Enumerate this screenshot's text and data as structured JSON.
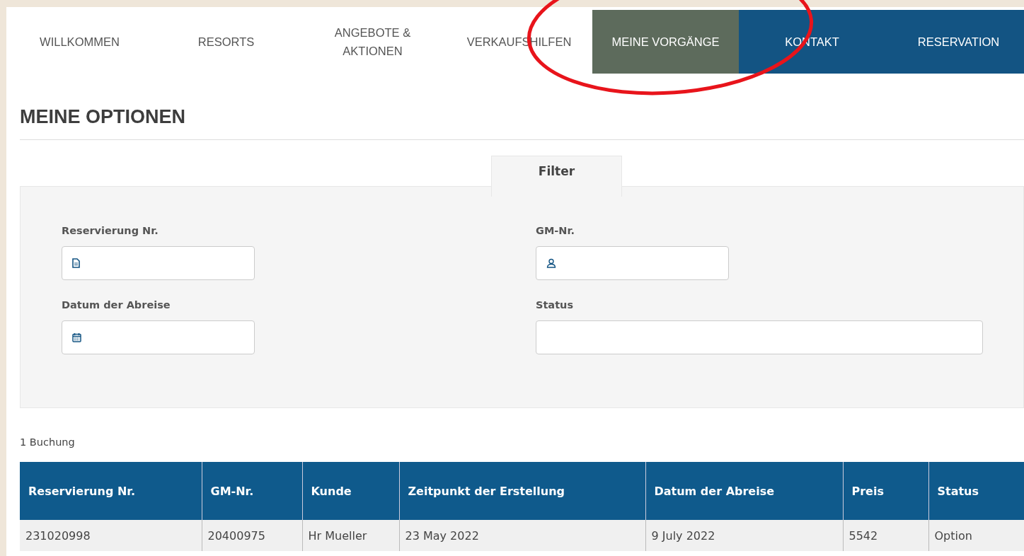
{
  "nav": [
    {
      "label": "WILLKOMMEN",
      "kind": "plain",
      "selected": false
    },
    {
      "label": "RESORTS",
      "kind": "plain",
      "selected": false
    },
    {
      "label": "ANGEBOTE & AKTIONEN",
      "kind": "plain",
      "selected": false
    },
    {
      "label": "VERKAUFSHILFEN",
      "kind": "plain",
      "selected": false
    },
    {
      "label": "MEINE VORGÄNGE",
      "kind": "plain",
      "selected": true
    },
    {
      "label": "KONTAKT",
      "kind": "cta",
      "selected": false
    },
    {
      "label": "RESERVATION",
      "kind": "cta",
      "selected": false
    }
  ],
  "page_title": "MEINE OPTIONEN",
  "filter": {
    "tab": "Filter",
    "fields": [
      {
        "label": "Reservierung Nr.",
        "kind": "document"
      },
      {
        "label": "GM-Nr.",
        "kind": "person"
      },
      {
        "label": "Datum der Abreise",
        "kind": "date"
      },
      {
        "label": "Status",
        "kind": "select"
      }
    ]
  },
  "result_count": "1 Buchung",
  "table": {
    "columns": [
      "Reservierung Nr.",
      "GM-Nr.",
      "Kunde",
      "Zeitpunkt der Erstellung",
      "Datum der Abreise",
      "Preis",
      "Status"
    ],
    "rows": [
      [
        "231020998",
        "20400975",
        "Hr Mueller",
        "23 May 2022",
        "9 July 2022",
        "5542",
        "Option"
      ]
    ]
  }
}
